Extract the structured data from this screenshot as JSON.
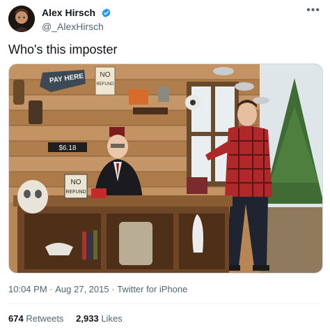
{
  "author": {
    "name": "Alex Hirsch",
    "handle": "@_AlexHirsch",
    "verified": true
  },
  "menu_icon": "more-horizontal-icon",
  "tweet": {
    "text": "Who's this imposter"
  },
  "media": {
    "signs": {
      "pay_here": "PAY HERE",
      "no_refund_top": "NO",
      "no_refund_bottom": "REFUND",
      "price": "$6.18",
      "no_refund_desk_top": "NO",
      "no_refund_desk_bottom": "REFUND"
    }
  },
  "meta": {
    "time": "10:04 PM",
    "separator": "·",
    "date": "Aug 27, 2015",
    "source": "Twitter for iPhone"
  },
  "stats": {
    "retweets_count": "674",
    "retweets_label": "Retweets",
    "likes_count": "2,933",
    "likes_label": "Likes"
  },
  "colors": {
    "verified": "#1d9bf0",
    "secondary_text": "#536471",
    "primary_text": "#0f1419"
  }
}
